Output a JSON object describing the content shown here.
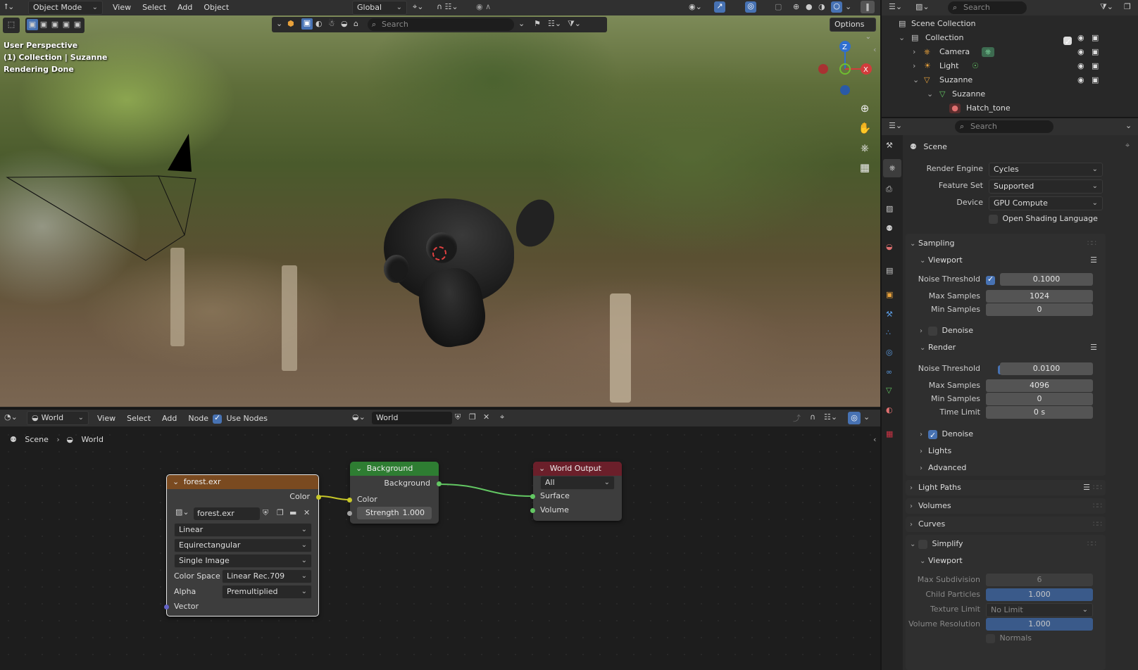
{
  "topbar": {
    "mode": "Object Mode",
    "menus": [
      "View",
      "Select",
      "Add",
      "Object"
    ],
    "transform_orientation": "Global",
    "search_placeholder": "Search"
  },
  "viewport": {
    "options_label": "Options",
    "info_lines": [
      "User Perspective",
      "(1) Collection | Suzanne",
      "Rendering Done"
    ],
    "gizmo_axes": [
      "Z",
      "X"
    ]
  },
  "outliner": {
    "search_placeholder": "Search",
    "root": "Scene Collection",
    "items": [
      {
        "label": "Collection",
        "depth": 0
      },
      {
        "label": "Camera",
        "depth": 1
      },
      {
        "label": "Light",
        "depth": 1
      },
      {
        "label": "Suzanne",
        "depth": 1
      },
      {
        "label": "Suzanne",
        "depth": 2
      },
      {
        "label": "Hatch_tone",
        "depth": 3
      }
    ]
  },
  "properties": {
    "search_placeholder": "Search",
    "context": "Scene",
    "render_engine": {
      "label": "Render Engine",
      "value": "Cycles"
    },
    "feature_set": {
      "label": "Feature Set",
      "value": "Supported"
    },
    "device": {
      "label": "Device",
      "value": "GPU Compute"
    },
    "osl": {
      "label": "Open Shading Language",
      "checked": false
    },
    "sampling": {
      "title": "Sampling",
      "viewport": {
        "title": "Viewport",
        "noise_threshold_label": "Noise Threshold",
        "noise_threshold": "0.1000",
        "max_samples_label": "Max Samples",
        "max_samples": "1024",
        "min_samples_label": "Min Samples",
        "min_samples": "0",
        "denoise_label": "Denoise"
      },
      "render": {
        "title": "Render",
        "noise_threshold_label": "Noise Threshold",
        "noise_threshold": "0.0100",
        "max_samples_label": "Max Samples",
        "max_samples": "4096",
        "min_samples_label": "Min Samples",
        "min_samples": "0",
        "time_limit_label": "Time Limit",
        "time_limit": "0 s",
        "denoise_label": "Denoise"
      },
      "lights": "Lights",
      "advanced": "Advanced"
    },
    "light_paths": "Light Paths",
    "volumes": "Volumes",
    "curves": "Curves",
    "simplify": {
      "title": "Simplify",
      "viewport_title": "Viewport",
      "max_subdivision_label": "Max Subdivision",
      "max_subdivision": "6",
      "child_particles_label": "Child Particles",
      "child_particles": "1.000",
      "texture_limit_label": "Texture Limit",
      "texture_limit": "No Limit",
      "volume_resolution_label": "Volume Resolution",
      "volume_resolution": "1.000",
      "normals_label": "Normals"
    }
  },
  "node_editor": {
    "editor_type": "World",
    "menus": [
      "View",
      "Select",
      "Add",
      "Node"
    ],
    "use_nodes": "Use Nodes",
    "world_name": "World",
    "breadcrumb": [
      "Scene",
      "World"
    ],
    "nodes": {
      "image": {
        "title": "forest.exr",
        "output": "Color",
        "image_name": "forest.exr",
        "interpolation": "Linear",
        "projection": "Equirectangular",
        "source": "Single Image",
        "color_space_label": "Color Space",
        "color_space": "Linear Rec.709",
        "alpha_label": "Alpha",
        "alpha": "Premultiplied",
        "vector": "Vector"
      },
      "background": {
        "title": "Background",
        "output": "Background",
        "color": "Color",
        "strength_label": "Strength",
        "strength": "1.000"
      },
      "output": {
        "title": "World Output",
        "target": "All",
        "surface": "Surface",
        "volume": "Volume"
      }
    }
  },
  "colors": {
    "accent": "#4772b3",
    "image_node_header": "#7a4a20",
    "background_node_header": "#2e7d32",
    "output_node_header": "#6b1f2a",
    "link_green": "#63c763",
    "socket_yellow": "#c7c729",
    "socket_purple": "#6363c7"
  }
}
